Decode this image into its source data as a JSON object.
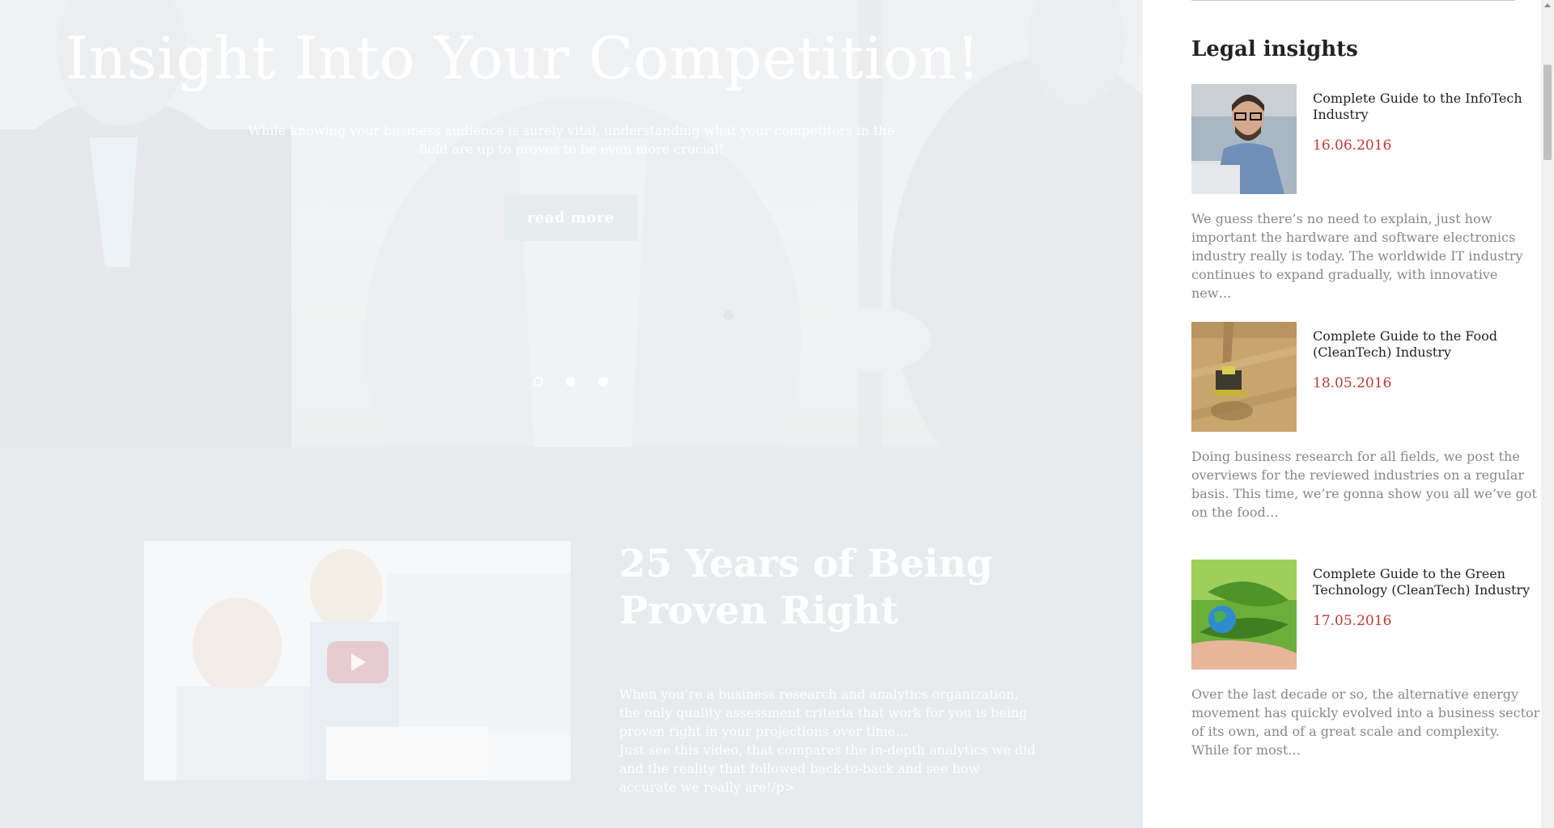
{
  "hero": {
    "title": "Insight Into Your Competition!",
    "subtitle": "While knowing your business audience is surely vital, understanding what your competitors in the field are up to proves to be even more crucial!",
    "button_label": "read more",
    "slides_total": 3,
    "active_slide": 1
  },
  "section": {
    "title": "25 Years of Being Proven Right",
    "text": "When you’re a business research and analytics organization, the only quality assessment criteria that work for you is being proven right in your projections over time…\nJust see this video, that compares the in-depth analytics we did and the reality that followed back-to-back and see how accurate we really are!/p>"
  },
  "sidebar": {
    "heading": "Legal insights",
    "posts": [
      {
        "title": "Complete Guide to the InfoTech Industry",
        "date": "16.06.2016",
        "excerpt": "We guess there’s no need to explain, just how important the hardware and software electronics industry really is today. The worldwide IT industry continues to expand gradually, with innovative new…",
        "thumb": "man-with-glasses-laptop"
      },
      {
        "title": "Complete Guide to the Food (CleanTech) Industry",
        "date": "18.05.2016",
        "excerpt": "Doing business research for all fields, we post the overviews for the reviewed industries on a regular basis. This time, we’re gonna show you all we’ve got on the food…",
        "thumb": "combine-harvester-field"
      },
      {
        "title": "Complete Guide to the Green Technology (CleanTech) Industry",
        "date": "17.05.2016",
        "excerpt": "Over the last decade or so, the alternative energy movement has quickly evolved into a business sector of its own, and of a great scale and complexity. While for most…",
        "thumb": "globe-in-hand-leaves"
      }
    ]
  },
  "colors": {
    "date": "#c7372f",
    "lower_bg": "#e7ebee",
    "heading": "#222222",
    "excerpt": "#888888"
  },
  "icons": {
    "play": "play-icon",
    "scroll_up": "scroll-up-arrow-icon"
  }
}
